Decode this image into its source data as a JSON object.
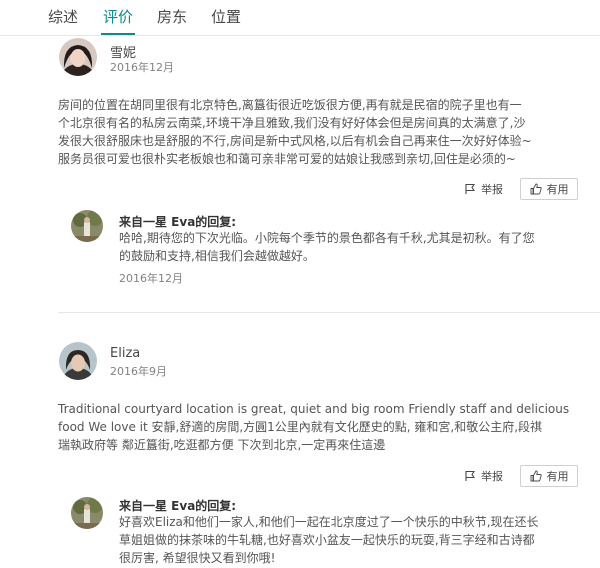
{
  "tabs": [
    {
      "label": "综述"
    },
    {
      "label": "评价"
    },
    {
      "label": "房东"
    },
    {
      "label": "位置"
    }
  ],
  "accent_color": "#0f8a8a",
  "reviews": [
    {
      "name": "雪妮",
      "date": "2016年12月",
      "text_lines": [
        "房间的位置在胡同里很有北京特色,离簋街很近吃饭很方便,再有就是民宿的院子里也有一",
        "个北京很有名的私房云南菜,环境干净且雅致,我们没有好好体会但是房间真的太满意了,沙",
        "发很大很舒服床也是舒服的不行,房间是新中式风格,以后有机会自己再来住一次好好体验~",
        "服务员很可爱也很朴实老板娘也和蔼可亲非常可爱的姑娘让我感到亲切,回住是必须的~"
      ],
      "report_label": "举报",
      "helpful_label": "有用",
      "reply": {
        "title": "来自一星 Eva的回复:",
        "text_lines": [
          "哈哈,期待您的下次光临。小院每个季节的景色都各有千秋,尤其是初秋。有了您",
          "的鼓励和支持,相信我们会越做越好。"
        ],
        "date": "2016年12月"
      }
    },
    {
      "name": "Eliza",
      "date": "2016年9月",
      "text_lines": [
        "Traditional courtyard location is great, quiet and big room  Friendly staff and delicious",
        "food We love it  安靜,舒適的房間,方圓1公里內就有文化歷史的點, 雍和宮,和敬公主府,段祺",
        "瑞執政府等 鄰近簋街,吃逛都方便 下次到北京,一定再來住這邊"
      ],
      "report_label": "举报",
      "helpful_label": "有用",
      "reply": {
        "title": "来自一星 Eva的回复:",
        "text_lines": [
          "好喜欢Eliza和他们一家人,和他们一起在北京度过了一个快乐的中秋节,现在还长",
          "草姐姐做的抹茶味的牛轧糖,也好喜欢小盆友一起快乐的玩耍,背三字经和古诗都",
          "很厉害, 希望很快又看到你哦!"
        ]
      }
    }
  ]
}
